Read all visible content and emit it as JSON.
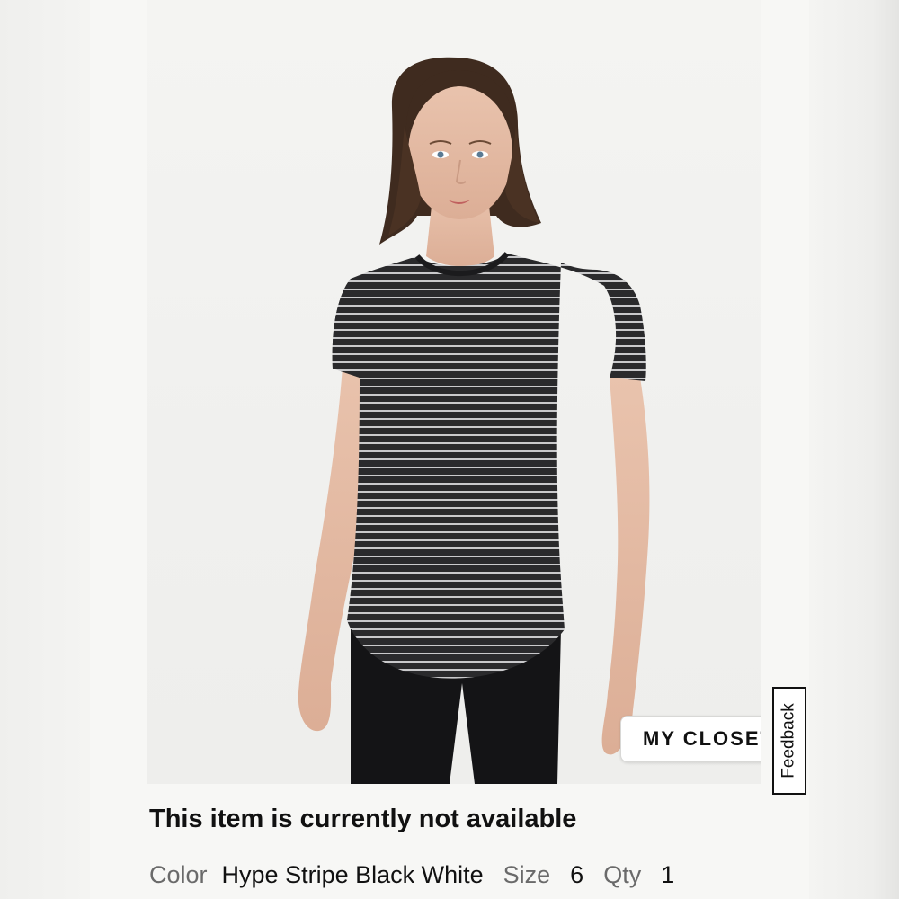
{
  "product": {
    "image_alt": "Model wearing striped short-sleeve tee",
    "my_closet_label": "MY CLOSET",
    "availability_message": "This item is currently not available",
    "color_label": "Color",
    "color_value": "Hype Stripe Black White",
    "size_label": "Size",
    "size_value": "6",
    "qty_label": "Qty",
    "qty_value": "1"
  },
  "feedback": {
    "label": "Feedback"
  },
  "colors": {
    "text_primary": "#111111",
    "text_muted": "#6a6a6a",
    "background": "#f7f7f5"
  }
}
